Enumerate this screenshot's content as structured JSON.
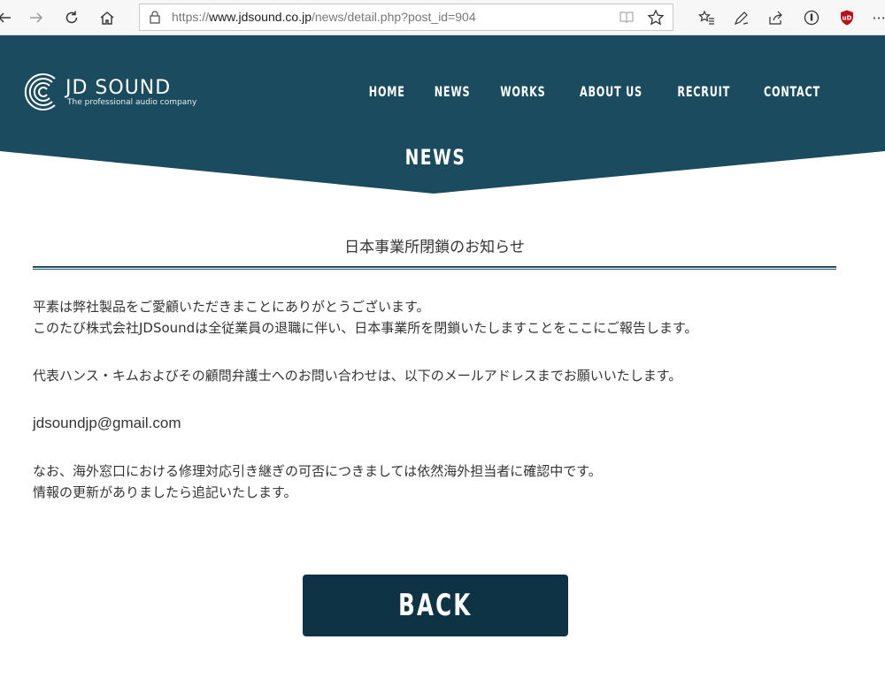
{
  "browser": {
    "url_prefix": "https://",
    "url_domain": "www.jdsound.co.jp",
    "url_path": "/news/detail.php?post_id=904",
    "more_label": "···"
  },
  "site": {
    "logo_text": "JD SOUND",
    "logo_tagline": "The professional audio company",
    "nav": [
      "HOME",
      "NEWS",
      "WORKS",
      "ABOUT US",
      "RECRUIT",
      "CONTACT"
    ],
    "section_title": "NEWS"
  },
  "article": {
    "title": "日本事業所閉鎖のお知らせ",
    "paragraph1_line1": "平素は弊社製品をご愛顧いただきまことにありがとうございます。",
    "paragraph1_line2": "このたび株式会社JDSoundは全従業員の退職に伴い、日本事業所を閉鎖いたしますことをここにご報告します。",
    "paragraph2": "代表ハンス・キムおよびその顧問弁護士へのお問い合わせは、以下のメールアドレスまでお願いいたします。",
    "email": "jdsoundjp@gmail.com",
    "paragraph4_line1": "なお、海外窓口における修理対応引き継ぎの可否につきましては依然海外担当者に確認中です。",
    "paragraph4_line2": "情報の更新がありましたら追記いたします。"
  },
  "back_button": {
    "label": "BACK"
  },
  "colors": {
    "header_bg": "#1a4b5e",
    "button_bg": "#0d3344",
    "rule": "#1f4f63",
    "ublock_red": "#b5121b"
  }
}
